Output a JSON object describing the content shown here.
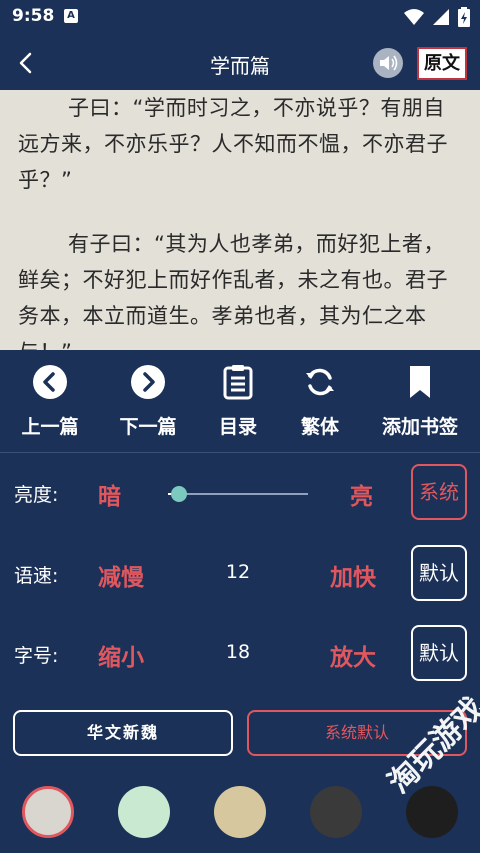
{
  "status": {
    "time": "9:58",
    "notification_letter": "A"
  },
  "header": {
    "title": "学而篇",
    "original_label": "原文"
  },
  "reading": {
    "paragraphs": [
      "子曰：“学而时习之，不亦说乎？有朋自远方来，不亦乐乎？人不知而不愠，不亦君子乎？”",
      "有子曰：“其为人也孝弟，而好犯上者，鲜矣；不好犯上而好作乱者，未之有也。君子务本，本立而道生。孝弟也者，其为仁之本与！”"
    ]
  },
  "toolbar": {
    "prev": "上一篇",
    "next": "下一篇",
    "toc": "目录",
    "traditional": "繁体",
    "bookmark": "添加书签"
  },
  "settings": {
    "brightness": {
      "label": "亮度:",
      "low": "暗",
      "high": "亮",
      "button": "系统",
      "level": 0.08
    },
    "speed": {
      "label": "语速:",
      "decrease": "减慢",
      "value": "12",
      "increase": "加快",
      "button": "默认"
    },
    "fontsize": {
      "label": "字号:",
      "decrease": "缩小",
      "value": "18",
      "increase": "放大",
      "button": "默认"
    }
  },
  "font": {
    "option_1": "华文新魏",
    "option_2": "系统默认"
  },
  "themes": [
    "#d9d6cf",
    "#c9ead0",
    "#d6c79e",
    "#3a3a3a",
    "#1e1e1e"
  ],
  "colors": {
    "accent": "#e0575e",
    "panel_bg": "#1b3158",
    "paper": "#e3e0d8"
  },
  "watermark": "淘玩游戏"
}
